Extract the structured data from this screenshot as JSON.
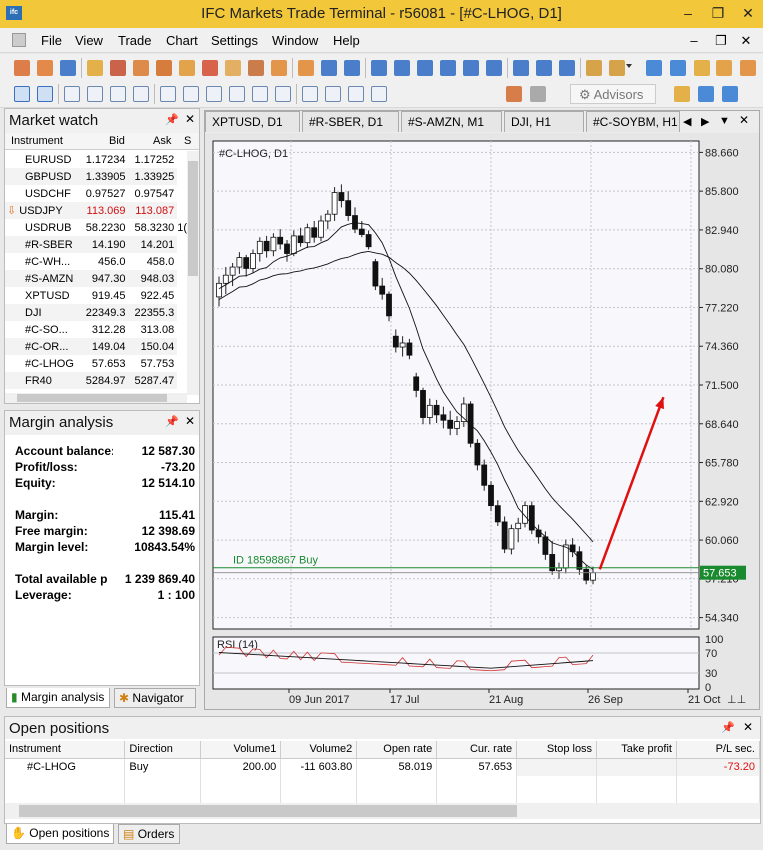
{
  "window": {
    "title": "IFC Markets Trade Terminal - r56081 - [#C-LHOG, D1]",
    "app_icon": "ifc",
    "minimize": "–",
    "restore": "❐",
    "close": "✕"
  },
  "menu": [
    "File",
    "View",
    "Trade",
    "Chart",
    "Settings",
    "Window",
    "Help"
  ],
  "mdi": {
    "minimize": "–",
    "restore": "❐",
    "close": "✕"
  },
  "toolbar2": {
    "advisors": "Advisors"
  },
  "market_watch": {
    "title": "Market watch",
    "columns": [
      "Instrument",
      "Bid",
      "Ask",
      "S"
    ],
    "rows": [
      {
        "instrument": "EURUSD",
        "bid": "1.17234",
        "ask": "1.17252"
      },
      {
        "instrument": "GBPUSD",
        "bid": "1.33905",
        "ask": "1.33925"
      },
      {
        "instrument": "USDCHF",
        "bid": "0.97527",
        "ask": "0.97547"
      },
      {
        "instrument": "USDJPY",
        "bid": "113.069",
        "ask": "113.087"
      },
      {
        "instrument": "USDRUB",
        "bid": "58.2230",
        "ask": "58.3230"
      },
      {
        "instrument": "#R-SBER",
        "bid": "14.190",
        "ask": "14.201"
      },
      {
        "instrument": "#C-WH...",
        "bid": "456.0",
        "ask": "458.0"
      },
      {
        "instrument": "#S-AMZN",
        "bid": "947.30",
        "ask": "948.03"
      },
      {
        "instrument": "XPTUSD",
        "bid": "919.45",
        "ask": "922.45"
      },
      {
        "instrument": "DJI",
        "bid": "22349.3",
        "ask": "22355.3"
      },
      {
        "instrument": "#C-SO...",
        "bid": "312.28",
        "ask": "313.08"
      },
      {
        "instrument": "#C-OR...",
        "bid": "149.04",
        "ask": "150.04"
      },
      {
        "instrument": "#C-LHOG",
        "bid": "57.653",
        "ask": "57.753"
      },
      {
        "instrument": "FR40",
        "bid": "5284.97",
        "ask": "5287.47"
      }
    ],
    "partial_col": "1("
  },
  "margin_analysis": {
    "title": "Margin analysis",
    "rows": [
      {
        "label": "Account balance:",
        "value": "12 587.30"
      },
      {
        "label": "Profit/loss:",
        "value": "-73.20"
      },
      {
        "label": "Equity:",
        "value": "12 514.10"
      },
      {
        "label": "",
        "value": ""
      },
      {
        "label": "Margin:",
        "value": "115.41"
      },
      {
        "label": "Free margin:",
        "value": "12 398.69"
      },
      {
        "label": "Margin level:",
        "value": "10843.54%"
      },
      {
        "label": "",
        "value": ""
      },
      {
        "label": "Total available p",
        "value": "1 239 869.40"
      },
      {
        "label": "Leverage:",
        "value": "1 : 100"
      }
    ]
  },
  "left_tabs": [
    "Margin analysis",
    "Navigator"
  ],
  "chart_tabs": [
    "XPTUSD, D1",
    "#R-SBER, D1",
    "#S-AMZN, M1",
    "DJI, H1",
    "#C-SOYBM, H1"
  ],
  "chart_data": {
    "type": "candlestick",
    "title": "#C-LHOG, D1",
    "y_ticks": [
      "88.660",
      "85.800",
      "82.940",
      "80.080",
      "77.220",
      "74.360",
      "71.500",
      "68.640",
      "65.780",
      "62.920",
      "60.060",
      "57.210",
      "54.340"
    ],
    "ylim": [
      53.5,
      89.5
    ],
    "x_ticks": [
      "09 Jun 2017",
      "17 Jul",
      "21 Aug",
      "26 Sep",
      "21 Oct"
    ],
    "current_price": "57.653",
    "order_line": {
      "label": "ID 18598867 Buy",
      "price": 58.019
    },
    "candles": [
      [
        78,
        79.5,
        77.3,
        79
      ],
      [
        79,
        80.2,
        78.2,
        79.6
      ],
      [
        79.6,
        80.5,
        78.8,
        80.2
      ],
      [
        80.2,
        81.3,
        79.7,
        80.9
      ],
      [
        80.9,
        81.1,
        79.5,
        80.1
      ],
      [
        80.1,
        81.5,
        79.8,
        81.2
      ],
      [
        81.2,
        82.4,
        80.6,
        82.1
      ],
      [
        82.1,
        82.5,
        80.9,
        81.4
      ],
      [
        81.4,
        82.7,
        81,
        82.4
      ],
      [
        82.4,
        83,
        81.5,
        81.9
      ],
      [
        81.9,
        82.2,
        80.6,
        81.2
      ],
      [
        81.2,
        82.9,
        81,
        82.5
      ],
      [
        82.5,
        83.1,
        81.7,
        82
      ],
      [
        82,
        83.4,
        81.6,
        83.1
      ],
      [
        83.1,
        83.6,
        82,
        82.4
      ],
      [
        82.4,
        84,
        82.1,
        83.6
      ],
      [
        83.6,
        84.4,
        83,
        84.1
      ],
      [
        84.1,
        86.1,
        83.6,
        85.7
      ],
      [
        85.7,
        86.3,
        84.6,
        85.1
      ],
      [
        85.1,
        85.8,
        83.6,
        84
      ],
      [
        84,
        84.6,
        82.7,
        83
      ],
      [
        83,
        83.6,
        82.4,
        82.6
      ],
      [
        82.6,
        82.9,
        81.5,
        81.7
      ],
      [
        80.6,
        80.8,
        78.5,
        78.8
      ],
      [
        78.8,
        79.4,
        77.8,
        78.2
      ],
      [
        78.2,
        78.4,
        76.2,
        76.6
      ],
      [
        75.1,
        75.6,
        73.9,
        74.3
      ],
      [
        74.3,
        75.1,
        73.6,
        74.6
      ],
      [
        74.6,
        74.9,
        73.4,
        73.7
      ],
      [
        72.1,
        72.4,
        70.6,
        71.1
      ],
      [
        71.1,
        71.3,
        68.6,
        69.1
      ],
      [
        69.1,
        70.5,
        68.6,
        70
      ],
      [
        70,
        70.4,
        68.7,
        69.3
      ],
      [
        69.3,
        69.9,
        68.3,
        68.9
      ],
      [
        68.9,
        69.6,
        67.8,
        68.3
      ],
      [
        68.3,
        69.2,
        67.8,
        68.8
      ],
      [
        68.8,
        70.6,
        68.4,
        70.1
      ],
      [
        70.1,
        70.3,
        66.9,
        67.2
      ],
      [
        67.2,
        67.5,
        65.2,
        65.6
      ],
      [
        65.6,
        66,
        63.7,
        64.1
      ],
      [
        64.1,
        64.4,
        62.2,
        62.6
      ],
      [
        62.6,
        63,
        61.1,
        61.4
      ],
      [
        61.4,
        61.8,
        59.1,
        59.4
      ],
      [
        59.4,
        61.2,
        59,
        60.9
      ],
      [
        60.9,
        61.7,
        59.9,
        61.3
      ],
      [
        61.3,
        62.9,
        61,
        62.6
      ],
      [
        62.6,
        62.9,
        60.5,
        60.8
      ],
      [
        60.8,
        61.2,
        59.8,
        60.3
      ],
      [
        60.3,
        60.7,
        58.6,
        59
      ],
      [
        59,
        60,
        57.5,
        57.8
      ],
      [
        57.8,
        58.4,
        57.2,
        58
      ],
      [
        58,
        60.1,
        57.6,
        59.7
      ],
      [
        59.7,
        60.2,
        58.8,
        59.2
      ],
      [
        59.2,
        59.6,
        57.5,
        57.9
      ],
      [
        57.9,
        58.2,
        56.8,
        57.1
      ],
      [
        57.1,
        58.1,
        56.8,
        57.653
      ]
    ],
    "arrow": {
      "from": [
        56,
        57.9
      ],
      "to": [
        66,
        70.6
      ],
      "color": "#e01010"
    },
    "rsi": {
      "label": "RSI (14)",
      "levels": [
        "100",
        "70",
        "30",
        "0"
      ]
    }
  },
  "open_positions": {
    "title": "Open positions",
    "columns": [
      "Instrument",
      "Direction",
      "Volume1",
      "Volume2",
      "Open rate",
      "Cur. rate",
      "Stop loss",
      "Take profit",
      "P/L sec."
    ],
    "rows": [
      {
        "instrument": "#C-LHOG",
        "direction": "Buy",
        "volume1": "200.00",
        "volume2": "-11 603.80",
        "open_rate": "58.019",
        "cur_rate": "57.653",
        "stop_loss": "",
        "take_profit": "",
        "pl": "-73.20"
      }
    ]
  },
  "bottom_tabs": [
    "Open positions",
    "Orders"
  ],
  "colors": {
    "titlebar": "#f2c83a",
    "bull": "#ffffff",
    "bear": "#ffffff",
    "arrow": "#e01010",
    "order_line": "#1a8a2e",
    "loss": "#e01010"
  }
}
